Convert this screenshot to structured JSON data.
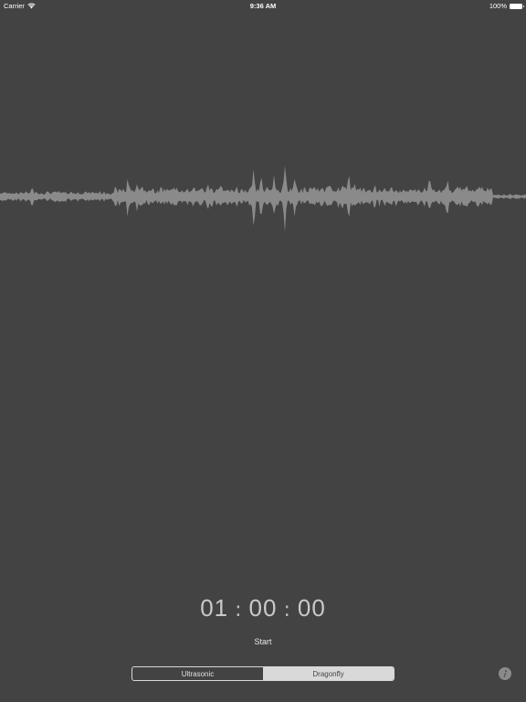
{
  "status_bar": {
    "carrier": "Carrier",
    "time": "9:36 AM",
    "battery": "100%"
  },
  "timer": {
    "hours": "01",
    "minutes": "00",
    "seconds": "00",
    "separator": ":"
  },
  "start_label": "Start",
  "mode_selector": {
    "options": [
      "Ultrasonic",
      "Dragonfly"
    ],
    "selected": "Dragonfly"
  },
  "colors": {
    "background": "#434343",
    "waveform": "#8a8a8a",
    "segment_selected": "#d9d9d9"
  },
  "icons": {
    "wifi": "wifi-icon",
    "battery": "battery-icon",
    "info": "info-icon"
  }
}
